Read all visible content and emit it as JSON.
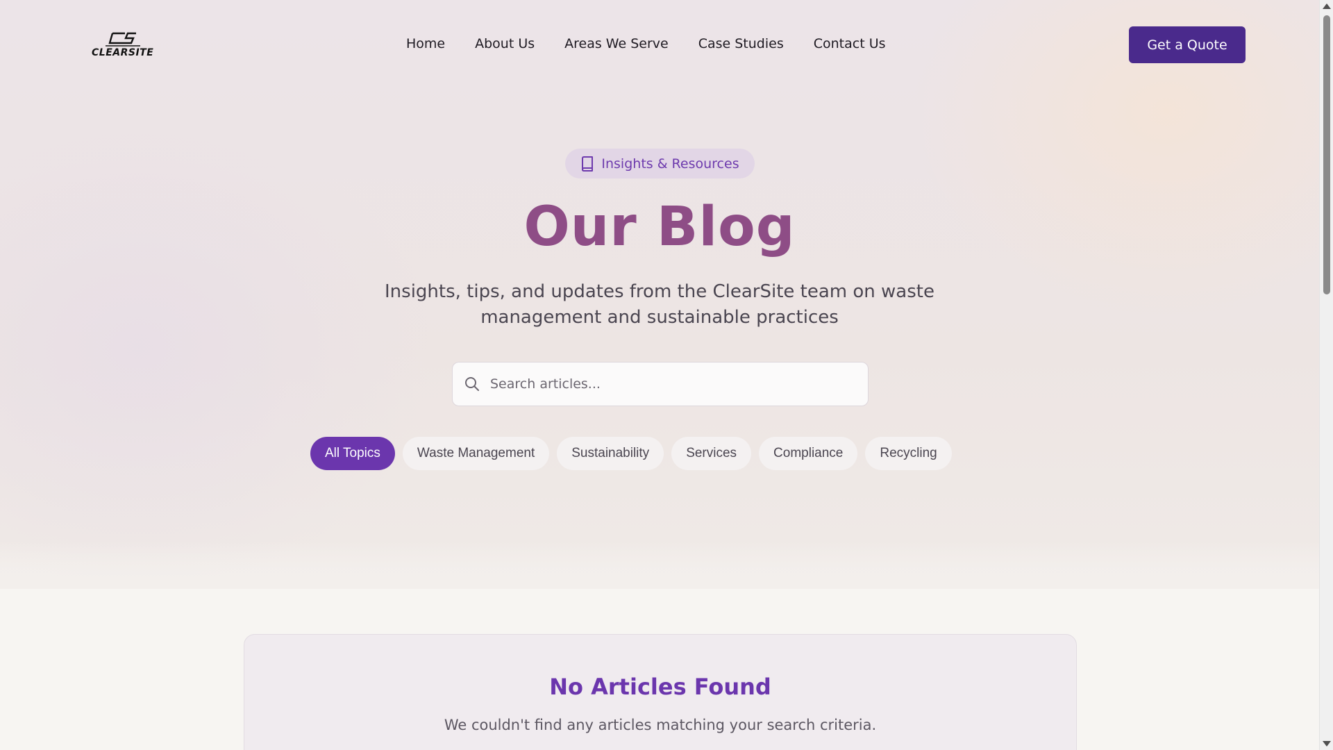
{
  "header": {
    "logo_text": "CLEARSITE",
    "nav": [
      "Home",
      "About Us",
      "Areas We Serve",
      "Case Studies",
      "Contact Us"
    ],
    "cta_label": "Get a Quote"
  },
  "hero": {
    "badge_label": "Insights & Resources",
    "badge_icon": "book-icon",
    "title": "Our Blog",
    "subtitle": "Insights, tips, and updates from the ClearSite team on waste management and sustainable practices",
    "search_placeholder": "Search articles...",
    "search_icon": "search-icon",
    "topics": [
      "All Topics",
      "Waste Management",
      "Sustainability",
      "Services",
      "Compliance",
      "Recycling"
    ],
    "active_topic": "All Topics"
  },
  "empty_state": {
    "title": "No Articles Found",
    "message": "We couldn't find any articles matching your search criteria."
  },
  "colors": {
    "brand_purple": "#4a2a8c",
    "accent_purple": "#6b36ad",
    "title_mauve": "#8e4d86"
  }
}
